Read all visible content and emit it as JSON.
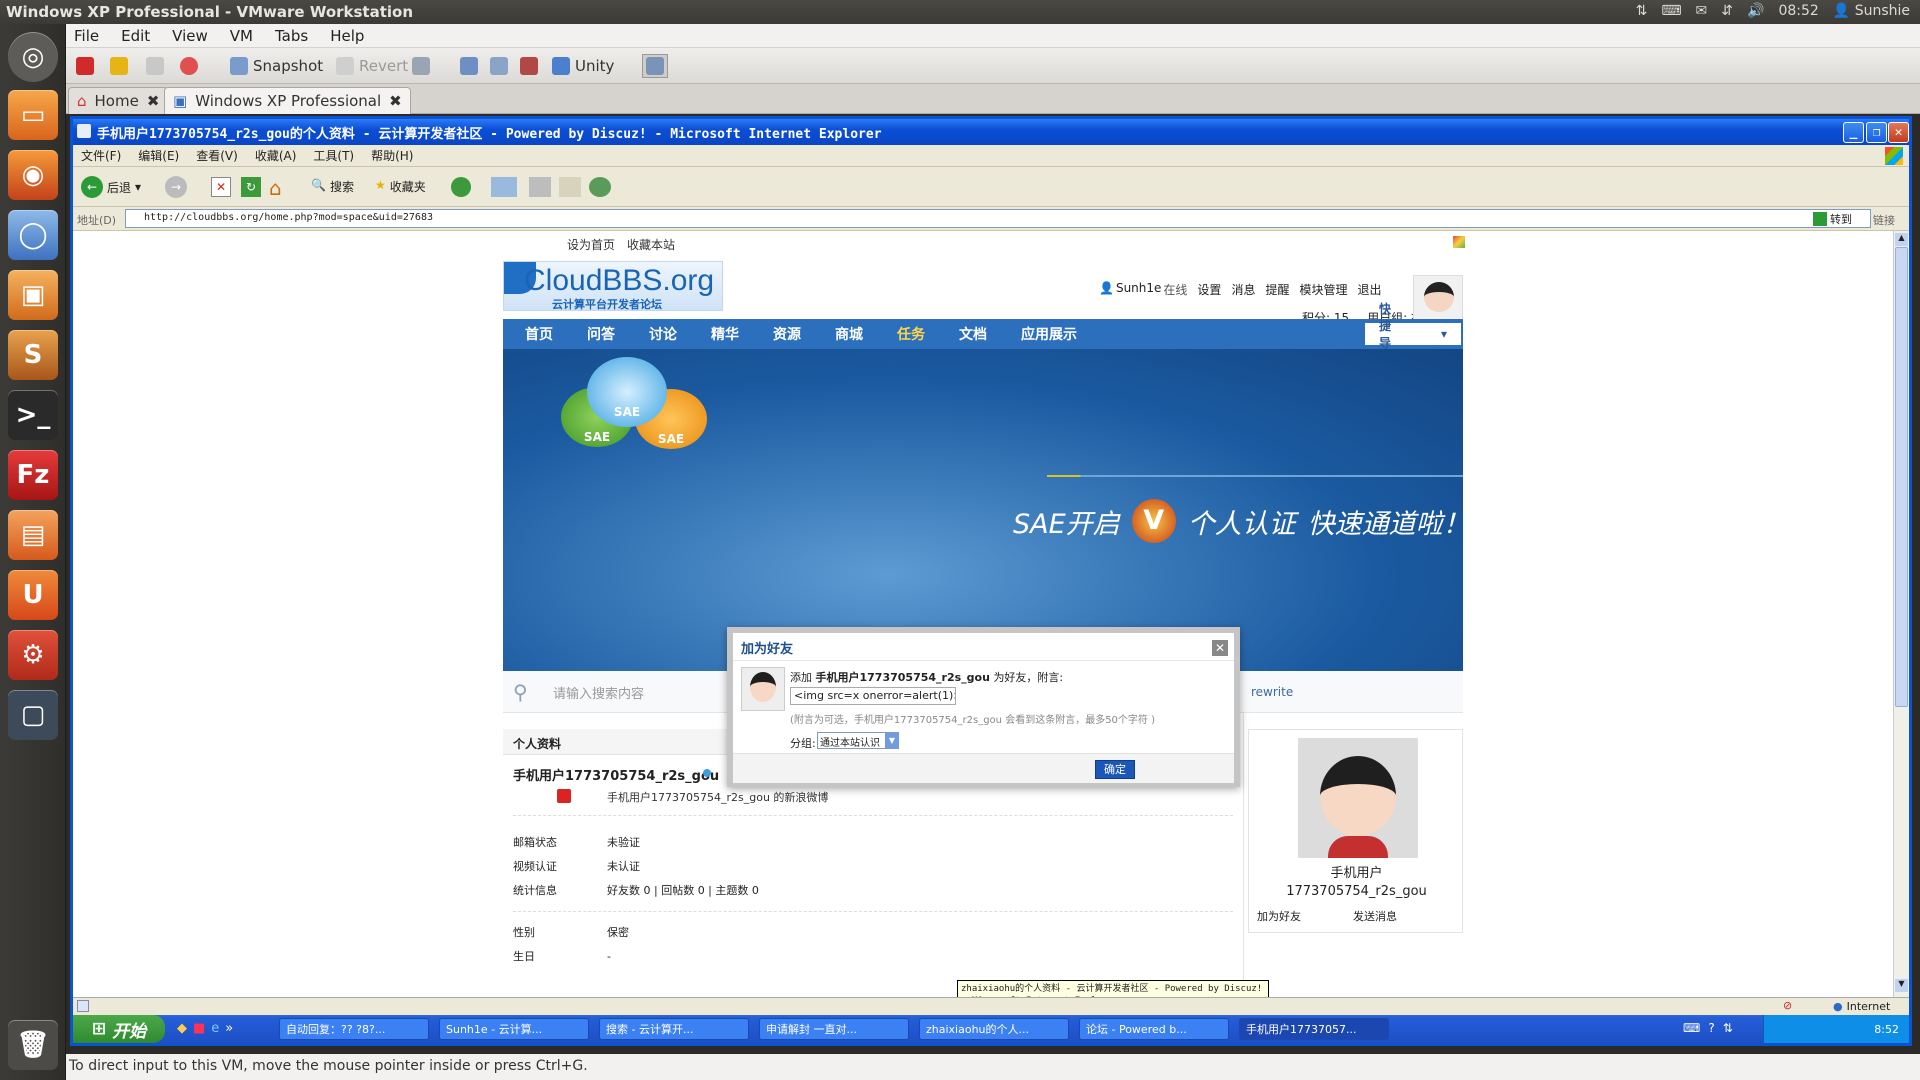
{
  "ubuntu": {
    "window_title": "Windows XP Professional - VMware Workstation",
    "clock": "08:52",
    "user": "Sunshie"
  },
  "vmware": {
    "menu": [
      "File",
      "Edit",
      "View",
      "VM",
      "Tabs",
      "Help"
    ],
    "toolbar": {
      "snapshot": "Snapshot",
      "revert": "Revert",
      "unity": "Unity"
    },
    "tabs": [
      {
        "label": "Home"
      },
      {
        "label": "Windows XP Professional"
      }
    ],
    "status": "To direct input to this VM, move the mouse pointer inside or press Ctrl+G."
  },
  "ie": {
    "title": "手机用户1773705754_r2s_gou的个人资料 - 云计算开发者社区 - Powered by Discuz! - Microsoft Internet Explorer",
    "menu": [
      "文件(F)",
      "编辑(E)",
      "查看(V)",
      "收藏(A)",
      "工具(T)",
      "帮助(H)"
    ],
    "toolbar": {
      "back": "后退",
      "search": "搜索",
      "favorites": "收藏夹"
    },
    "address_label": "地址(D)",
    "address": "http://cloudbbs.org/home.php?mod=space&uid=27683",
    "go": "转到",
    "links": "链接",
    "zone": "Internet",
    "tooltip": "zhaixiaohu的个人资料 - 云计算开发者社区 - Powered by Discuz! - Microsoft Internet Explorer"
  },
  "site": {
    "top_links": [
      "设为首页",
      "收藏本站"
    ],
    "logo": "CloudBBS.org",
    "logo_sub": "云计算平台开发者论坛",
    "user": {
      "name": "Sunh1e",
      "online": "在线",
      "links": [
        "设置",
        "消息",
        "提醒",
        "模块管理",
        "退出"
      ],
      "points": "积分: 15",
      "group": "用户组: 初来乍到"
    },
    "nav": [
      "首页",
      "问答",
      "讨论",
      "精华",
      "资源",
      "商城",
      "任务",
      "文档",
      "应用展示"
    ],
    "quick_nav": "快捷导航",
    "banner": {
      "cloud_labels": [
        "SAE",
        "SAE",
        "SAE"
      ],
      "text_a": "SAE开启",
      "text_b": "个人认证",
      "text_c": "快速通道啦！"
    },
    "search_placeholder": "请输入搜索内容",
    "rewrite": "rewrite",
    "profile_header": "个人资料",
    "profile_name": "手机用户1773705754_r2s_gou",
    "weibo": "手机用户1773705754_r2s_gou 的新浪微博",
    "rows": [
      {
        "label": "邮箱状态",
        "value": "未验证"
      },
      {
        "label": "视频认证",
        "value": "未认证"
      },
      {
        "label": "统计信息",
        "value": "好友数 0 | 回帖数 0 | 主题数 0"
      }
    ],
    "rows2": [
      {
        "label": "性别",
        "value": "保密"
      },
      {
        "label": "生日",
        "value": "-"
      }
    ],
    "side_name_a": "手机用户",
    "side_name_b": "1773705754_r2s_gou",
    "side_links": [
      "加为好友",
      "发送消息"
    ]
  },
  "dialog": {
    "title": "加为好友",
    "prompt_prefix": "添加",
    "prompt_user": "手机用户1773705754_r2s_gou",
    "prompt_suffix": "为好友，附言:",
    "note_value": "<img src=x onerror=alert(1)>",
    "hint": "(附言为可选，手机用户1773705754_r2s_gou 会看到这条附言，最多50个字符 )",
    "group_label": "分组:",
    "group_value": "通过本站认识",
    "ok": "确定"
  },
  "taskbar": {
    "start": "开始",
    "items": [
      "自动回复：?? ?8?...",
      "Sunh1e - 云计算...",
      "搜索 - 云计算开...",
      "申请解封 一直对...",
      "zhaixiaohu的个人...",
      "论坛 - Powered b...",
      "手机用户17737057..."
    ],
    "time": "8:52"
  },
  "colors": {
    "xp_blue": "#0a53d3",
    "nav_blue": "#2c6fbd",
    "ok_blue": "#1a57b8"
  }
}
